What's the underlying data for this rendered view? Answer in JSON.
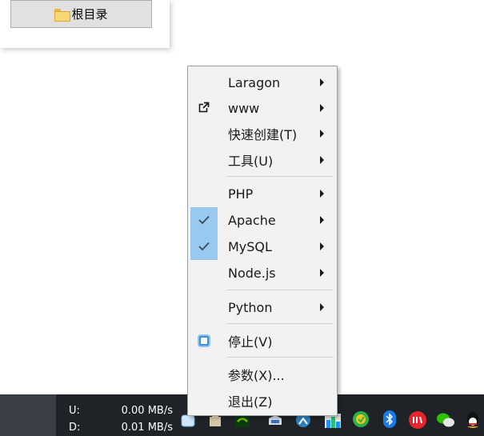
{
  "background_window": {
    "root_button_label": "根目录"
  },
  "menu": {
    "items": [
      {
        "label": "Laragon",
        "submenu": true
      },
      {
        "label": "www",
        "submenu": true,
        "icon": "external-link-icon"
      },
      {
        "label": "快速创建(T)",
        "submenu": true
      },
      {
        "label": "工具(U)",
        "submenu": true
      },
      {
        "label": "PHP",
        "submenu": true
      },
      {
        "label": "Apache",
        "submenu": true,
        "checked": true
      },
      {
        "label": "MySQL",
        "submenu": true,
        "checked": true
      },
      {
        "label": "Node.js",
        "submenu": true
      },
      {
        "label": "Python",
        "submenu": true
      },
      {
        "label": "停止(V)",
        "submenu": false,
        "icon": "stop-icon"
      },
      {
        "label": "参数(X)...",
        "submenu": false
      },
      {
        "label": "退出(Z)",
        "submenu": false
      }
    ]
  },
  "taskbar": {
    "upload_label": "U:",
    "upload_value": "0.00 MB/s",
    "download_label": "D:",
    "download_value": "0.01 MB/s"
  },
  "colors": {
    "menu_bg": "#f2f2f2",
    "check_highlight": "#99c9ef",
    "taskbar_bg": "#1f2327"
  }
}
